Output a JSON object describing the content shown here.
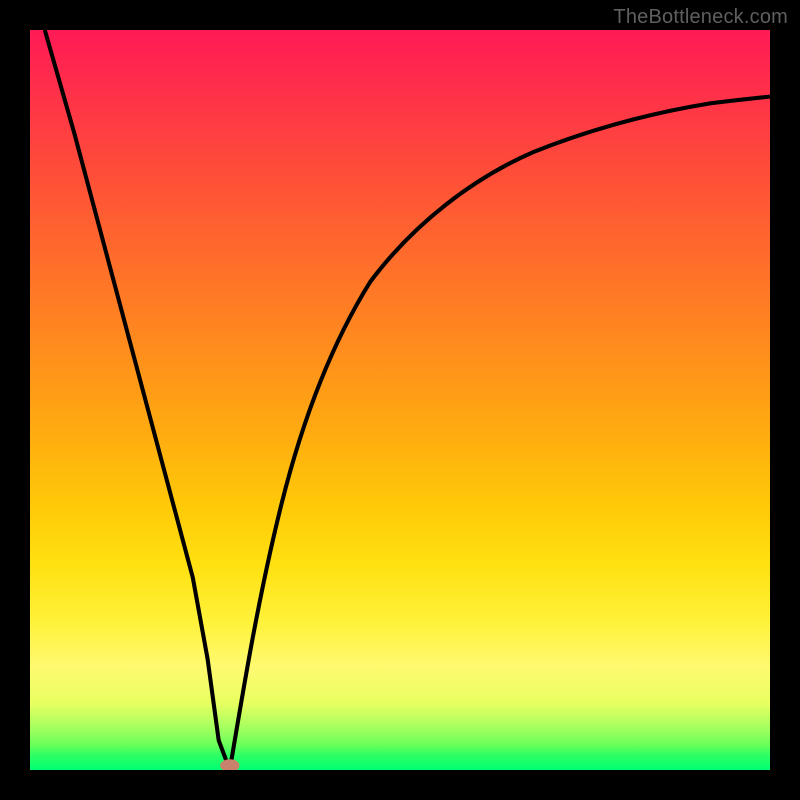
{
  "watermark": "TheBottleneck.com",
  "chart_data": {
    "type": "line",
    "title": "",
    "xlabel": "",
    "ylabel": "",
    "xlim": [
      0,
      100
    ],
    "ylim": [
      0,
      100
    ],
    "grid": false,
    "legend": false,
    "series": [
      {
        "name": "curve",
        "x": [
          2,
          6,
          10,
          14,
          18,
          22,
          24,
          25.5,
          27,
          29,
          31,
          34,
          38,
          44,
          52,
          60,
          68,
          76,
          84,
          92,
          100
        ],
        "y": [
          100,
          86,
          71,
          56,
          41,
          26,
          15,
          4,
          0,
          10,
          22,
          36,
          50,
          62,
          72,
          79,
          83.5,
          86.7,
          88.8,
          90.1,
          91
        ]
      }
    ],
    "marker": {
      "x": 27,
      "y": 0,
      "color": "#c9836c",
      "shape": "oval"
    },
    "background_gradient": {
      "stops": [
        {
          "pos": 0,
          "color": "#ff1a55"
        },
        {
          "pos": 50,
          "color": "#ff9a18"
        },
        {
          "pos": 80,
          "color": "#fff23a"
        },
        {
          "pos": 100,
          "color": "#00ff73"
        }
      ]
    }
  }
}
